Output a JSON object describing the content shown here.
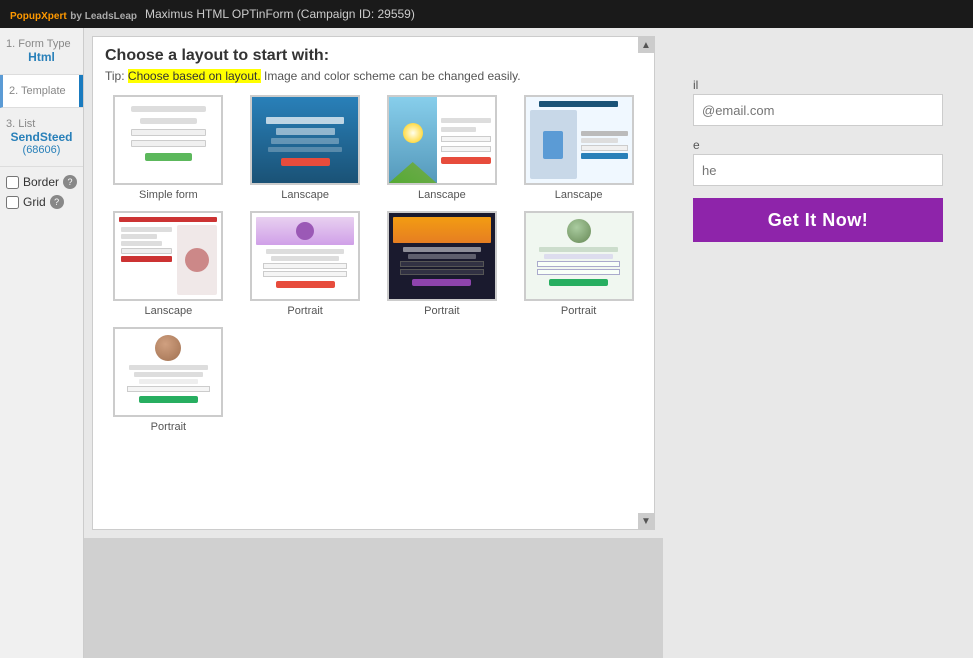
{
  "app": {
    "name": "PopupXpert",
    "by": "by LeadsLeap",
    "title": "Maximus HTML OPTinForm (Campaign ID: 29559)"
  },
  "sidebar": {
    "items": [
      {
        "step": "1.",
        "label": "Form Type",
        "value": "Html"
      },
      {
        "step": "2.",
        "label": "Template",
        "value": ""
      },
      {
        "step": "3.",
        "label": "List",
        "value": "SendSteed",
        "sub": "(68606)"
      }
    ],
    "options": [
      {
        "label": "Border",
        "checked": false
      },
      {
        "label": "Grid",
        "checked": false
      }
    ]
  },
  "layout_chooser": {
    "heading": "Choose a layout to start with:",
    "tip_prefix": "Tip: ",
    "tip_highlight": "Choose based on layout.",
    "tip_suffix": " Image and color scheme can be changed easily.",
    "layouts": [
      {
        "label": "Simple form",
        "type": "simple"
      },
      {
        "label": "Lanscape",
        "type": "lanscape1"
      },
      {
        "label": "Lanscape",
        "type": "lanscape2"
      },
      {
        "label": "Lanscape",
        "type": "lanscape3"
      },
      {
        "label": "Lanscape",
        "type": "lanscape4"
      },
      {
        "label": "Portrait",
        "type": "portrait1"
      },
      {
        "label": "Portrait",
        "type": "portrait2"
      },
      {
        "label": "Portrait",
        "type": "portrait3"
      },
      {
        "label": "Portrait",
        "type": "last"
      }
    ]
  },
  "form_preview": {
    "email_label": "il",
    "email_placeholder": "@email.com",
    "name_label": "e",
    "name_placeholder": "he",
    "submit_label": "Get It Now!"
  }
}
